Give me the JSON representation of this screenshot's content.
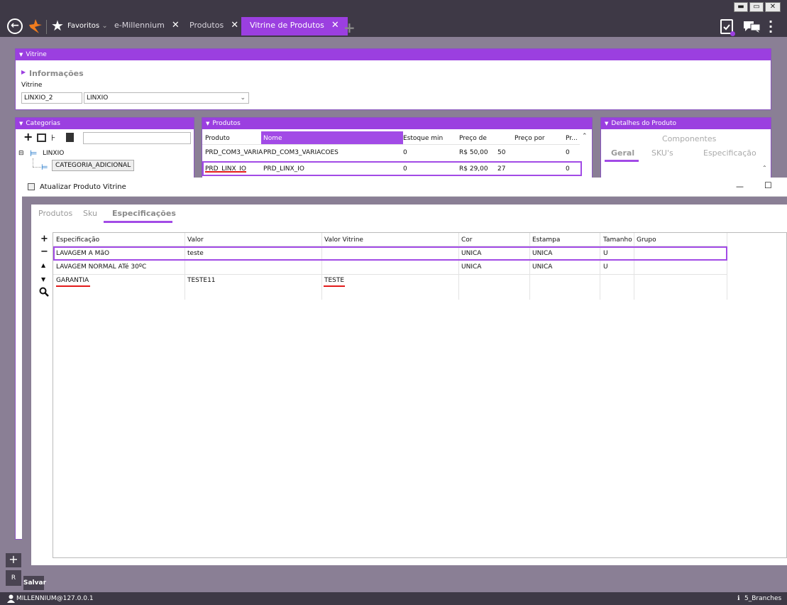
{
  "window_controls": {
    "minimize": "▬",
    "maximize": "▭",
    "close": "✕"
  },
  "topbar": {
    "favoritos_label": "Favoritos",
    "tabs": [
      {
        "label": "e-Millennium"
      },
      {
        "label": "Produtos"
      },
      {
        "label": "Vitrine de Produtos"
      }
    ],
    "add_tab": "+"
  },
  "vitrine_panel": {
    "header": "Vitrine",
    "section_label": "Informações",
    "field_label": "Vitrine",
    "code_value": "LINXIO_2",
    "name_value": "LINXIO"
  },
  "categorias_panel": {
    "header": "Categorias",
    "search_value": "",
    "tree_root": "LINXIO",
    "tree_child": "CATEGORIA_ADICIONAL"
  },
  "produtos_panel": {
    "header": "Produtos",
    "columns": [
      "Produto",
      "Nome",
      "Estoque min",
      "Preço de",
      "Preço por",
      "Pr..."
    ],
    "rows": [
      [
        "PRD_COM3_VARIA",
        "PRD_COM3_VARIACOES",
        "0",
        "R$ 50,00",
        "50",
        "0"
      ],
      [
        "PRD_LINX_IO",
        "PRD_LINX_IO",
        "0",
        "R$ 29,00",
        "27",
        "0"
      ]
    ]
  },
  "detalhes_panel": {
    "header": "Detalhes do Produto",
    "top_tab": "Componentes",
    "tabs": [
      "Geral",
      "SKU's",
      "Especificação"
    ]
  },
  "dialog": {
    "title": "Atualizar Produto Vitrine",
    "minimize": "—",
    "maximize": "☐",
    "tabs": [
      "Produtos",
      "Sku",
      "Especificações"
    ],
    "columns": [
      "Especificação",
      "Valor",
      "Valor Vitrine",
      "Cor",
      "Estampa",
      "Tamanho",
      "Grupo"
    ],
    "rows": [
      [
        "LAVAGEM A MãO",
        "teste",
        "",
        "UNICA",
        "UNICA",
        "U",
        ""
      ],
      [
        "LAVAGEM NORMAL ATé 30ºC",
        "",
        "",
        "UNICA",
        "UNICA",
        "U",
        ""
      ],
      [
        "GARANTIA",
        "TESTE11",
        "TESTE",
        "",
        "",
        "",
        ""
      ]
    ],
    "side_buttons": {
      "add": "+",
      "remove": "−",
      "up": "▲",
      "down": "▼"
    },
    "save_label": "Salvar"
  },
  "statusbar": {
    "user": "MILLENNIUM@127.0.0.1",
    "branch": "5_Branches"
  },
  "colors": {
    "accent": "#9b3fe0",
    "chrome": "#3e3946",
    "highlight": "#e31b1b"
  }
}
